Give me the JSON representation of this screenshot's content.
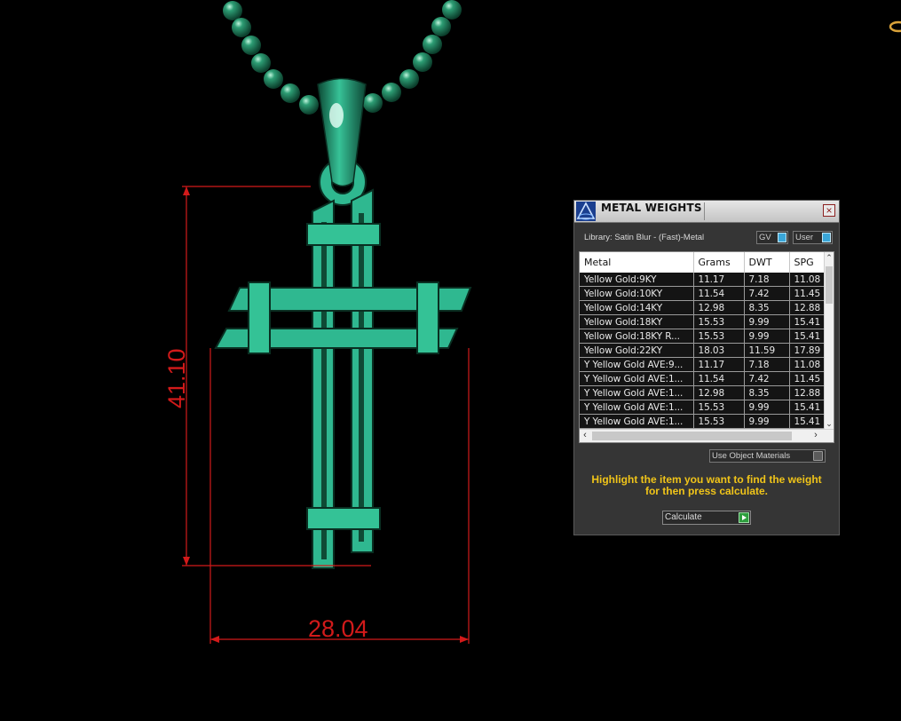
{
  "viewport": {
    "dimension_height": "41.10",
    "dimension_width": "28.04",
    "dimension_color": "#d21a1a",
    "model_color": "#2fb890"
  },
  "panel": {
    "title": "METAL WEIGHTS",
    "close_icon": "close-icon",
    "library_label": "Library: Satin Blur - (Fast)-Metal",
    "toggle_gv": "GV",
    "toggle_user": "User",
    "columns": [
      "Metal",
      "Grams",
      "DWT",
      "SPG"
    ],
    "rows": [
      [
        "Yellow Gold:9KY",
        "11.17",
        "7.18",
        "11.08"
      ],
      [
        "Yellow Gold:10KY",
        "11.54",
        "7.42",
        "11.45"
      ],
      [
        "Yellow Gold:14KY",
        "12.98",
        "8.35",
        "12.88"
      ],
      [
        "Yellow Gold:18KY",
        "15.53",
        "9.99",
        "15.41"
      ],
      [
        "Yellow Gold:18KY R...",
        "15.53",
        "9.99",
        "15.41"
      ],
      [
        "Yellow Gold:22KY",
        "18.03",
        "11.59",
        "17.89"
      ],
      [
        "Y Yellow Gold AVE:9...",
        "11.17",
        "7.18",
        "11.08"
      ],
      [
        "Y Yellow Gold AVE:1...",
        "11.54",
        "7.42",
        "11.45"
      ],
      [
        "Y Yellow Gold AVE:1...",
        "12.98",
        "8.35",
        "12.88"
      ],
      [
        "Y Yellow Gold AVE:1...",
        "15.53",
        "9.99",
        "15.41"
      ],
      [
        "Y Yellow Gold AVE:1...",
        "15.53",
        "9.99",
        "15.41"
      ]
    ],
    "use_object_materials": "Use Object Materials",
    "hint": "Highlight the item you want to find the weight for then press calculate.",
    "calculate": "Calculate",
    "hint_color": "#f0c419"
  }
}
